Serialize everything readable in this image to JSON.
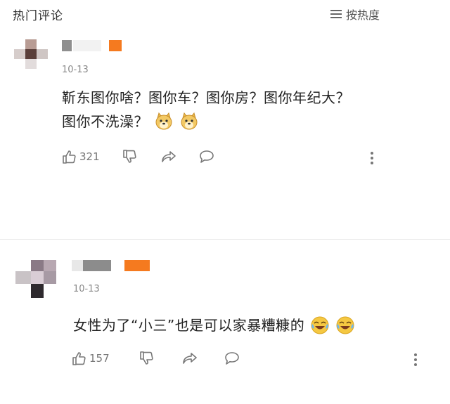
{
  "header": {
    "title": "热门评论",
    "sort_label": "按热度",
    "sort_icon": "menu-lines-icon"
  },
  "comments": [
    {
      "date": "10-13",
      "text_line1": "靳东图你啥？图你车？图你房？图你年纪大？",
      "text_line2": "图你不洗澡？",
      "emoji": [
        "doge-emoji",
        "doge-emoji"
      ],
      "likes": "321"
    },
    {
      "date": "10-13",
      "text": "女性为了“小三”也是可以家暴糟糠的",
      "emoji": [
        "crying-laughing-emoji",
        "crying-laughing-emoji"
      ],
      "likes": "157"
    }
  ],
  "colors": {
    "tag": "#f57a1f",
    "icon": "#777777",
    "date": "#888888"
  }
}
